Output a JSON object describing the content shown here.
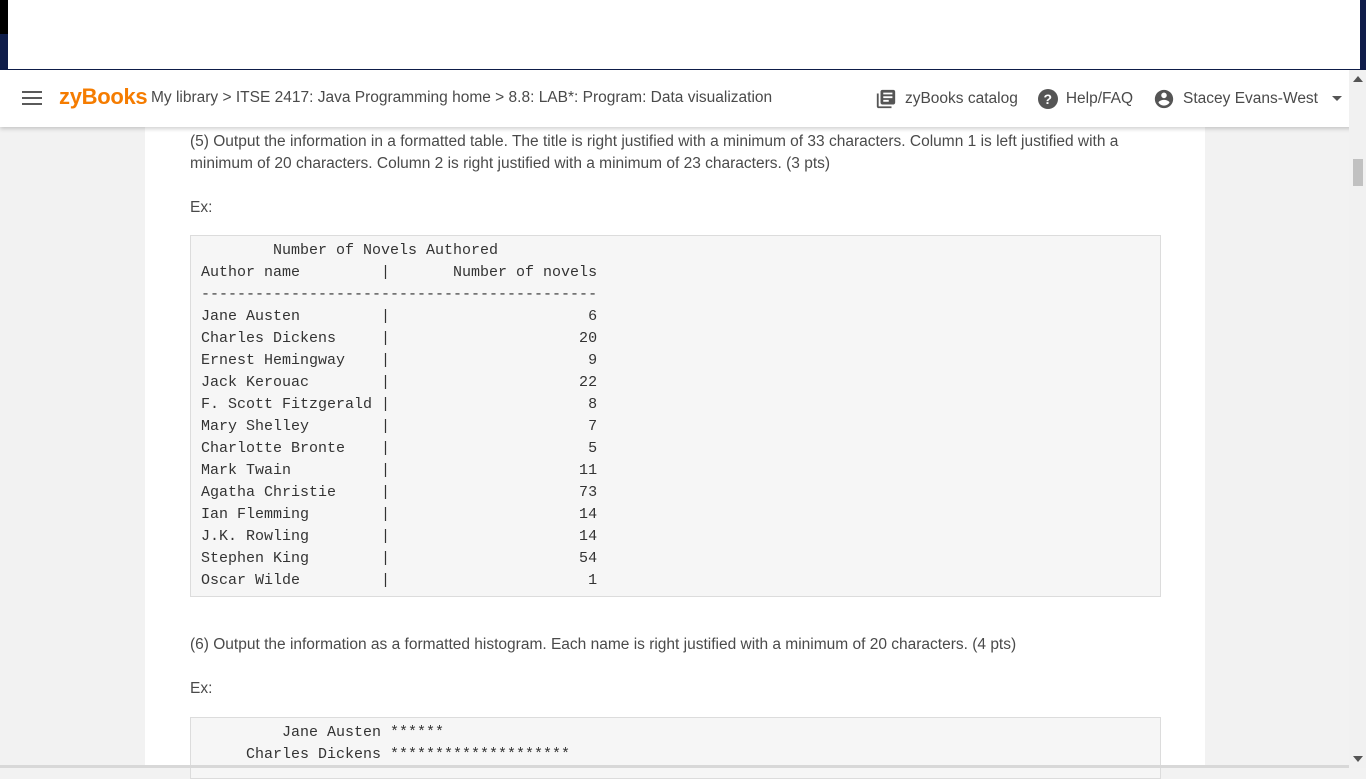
{
  "header": {
    "logo": "zyBooks",
    "breadcrumb": {
      "my_library": "My library",
      "sep": " > ",
      "course": "ITSE 2417: Java Programming home",
      "section": "8.8: LAB*: Program: Data visualization"
    },
    "catalog": "zyBooks catalog",
    "help": "Help/FAQ",
    "user": "Stacey Evans-West"
  },
  "icons": {
    "menu": "hamburger-menu-icon",
    "catalog": "library-books-icon",
    "help": "help-circle-icon",
    "user": "account-circle-icon",
    "dropdown": "chevron-down-icon"
  },
  "content": {
    "step5_text": "(5) Output the information in a formatted table. The title is right justified with a minimum of 33 characters. Column 1 is left justified with a minimum of 20 characters. Column 2 is right justified with a minimum of 23 characters. (3 pts)",
    "ex_label_1": "Ex:",
    "table_title": "        Number of Novels Authored",
    "table_header": "Author name         |       Number of novels",
    "table_divider": "--------------------------------------------",
    "table_rows": [
      "Jane Austen         |                      6",
      "Charles Dickens     |                     20",
      "Ernest Hemingway    |                      9",
      "Jack Kerouac        |                     22",
      "F. Scott Fitzgerald |                      8",
      "Mary Shelley        |                      7",
      "Charlotte Bronte    |                      5",
      "Mark Twain          |                     11",
      "Agatha Christie     |                     73",
      "Ian Flemming        |                     14",
      "J.K. Rowling        |                     14",
      "Stephen King        |                     54",
      "Oscar Wilde         |                      1"
    ],
    "step6_text": "(6) Output the information as a formatted histogram. Each name is right justified with a minimum of 20 characters. (4 pts)",
    "ex_label_2": "Ex:",
    "histogram_lines": [
      "         Jane Austen ******",
      "     Charles Dickens ********************"
    ]
  },
  "colors": {
    "brand_orange": "#f57c00",
    "top_band": "#0f1d4a",
    "text_gray": "#4a4a4a",
    "code_bg": "#f6f6f6"
  }
}
